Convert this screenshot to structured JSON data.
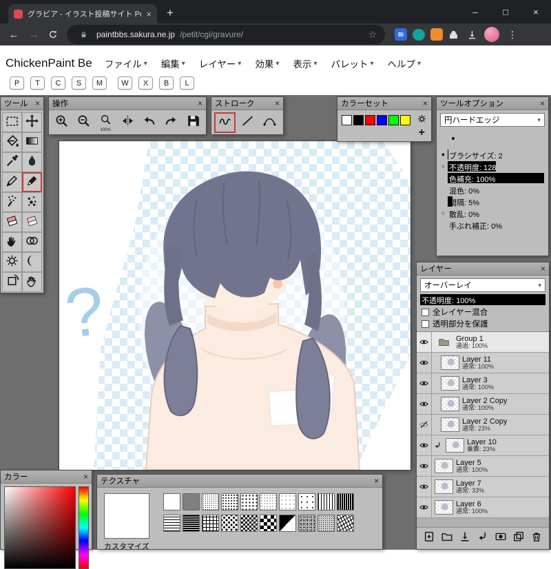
{
  "ui": {
    "close_glyph": "×",
    "caret": "▾"
  },
  "browser": {
    "tab": {
      "title": "グラビア - イラスト投稿サイト Petit N"
    },
    "new_tab_button": "+",
    "window_controls": {
      "minimize": "–",
      "maximize": "□",
      "close": "×"
    },
    "nav": {
      "back": "←",
      "forward": "→"
    },
    "omnibox": {
      "domain": "paintbbs.sakura.ne.jp",
      "path": "/petit/cgi/gravure/",
      "star": "☆"
    },
    "extensions": [
      {
        "label": "Bl",
        "color": "#2f6bdf",
        "shape": "square"
      },
      {
        "label": "",
        "color": "#17a398",
        "shape": "circle"
      },
      {
        "label": "",
        "color": "#ef8b2d",
        "shape": "square"
      }
    ],
    "menu_dots": "⋮"
  },
  "app": {
    "title": "ChickenPaint Be",
    "menus": [
      "ファイル",
      "編集",
      "レイヤー",
      "効果",
      "表示",
      "パレット",
      "ヘルプ"
    ],
    "shortcut_keys": [
      "P",
      "T",
      "C",
      "S",
      "M",
      "W",
      "X",
      "B",
      "L"
    ]
  },
  "palettes": {
    "tool": {
      "title": "ツール",
      "selected": "pen",
      "tools": [
        "rect-select",
        "move",
        "flood-fill",
        "gradient",
        "color-picker",
        "water",
        "pencil",
        "pen",
        "airbrush",
        "dots",
        "eraser",
        "soft-eraser",
        "smudge",
        "blend",
        "dodge",
        "burn",
        "rotate-canvas",
        "hand"
      ]
    },
    "misc": {
      "title": "操作",
      "actions": [
        {
          "id": "zoom-in"
        },
        {
          "id": "zoom-out"
        },
        {
          "id": "zoom-100",
          "label": "100%"
        },
        {
          "id": "flip-horizontal"
        },
        {
          "id": "undo"
        },
        {
          "id": "redo"
        },
        {
          "id": "save"
        }
      ]
    },
    "stroke": {
      "title": "ストローク",
      "selected": "freehand",
      "modes": [
        "freehand",
        "line",
        "bezier"
      ]
    },
    "swatches": {
      "title": "カラーセット",
      "plus": "+",
      "colors": [
        "#ffffff",
        "#000000",
        "#ff0000",
        "#0000ff",
        "#00ff00",
        "#ffff00"
      ]
    },
    "brush": {
      "title": "ツールオプション",
      "tip_name": "円ハードエッジ",
      "settings": [
        {
          "label": "ブラシサイズ: 2",
          "fill": 1,
          "circle": "filled"
        },
        {
          "label": "不透明度: 128",
          "fill": 50,
          "circle": "empty"
        },
        {
          "label": "色補充: 100%",
          "fill": 100,
          "circle": null
        },
        {
          "label": "混色: 0%",
          "fill": 0,
          "circle": null
        },
        {
          "label": "間隔: 5%",
          "fill": 5,
          "circle": null
        },
        {
          "label": "散乱: 0%",
          "fill": 0,
          "circle": "empty"
        },
        {
          "label": "手ぶれ補正: 0%",
          "fill": 0,
          "circle": null
        }
      ]
    },
    "layers": {
      "title": "レイヤー",
      "blend_mode": "オーバーレイ",
      "opacity_label": "不透明度: 100%",
      "opacity_fill": 100,
      "checkboxes": [
        "全レイヤー混合",
        "透明部分を保護"
      ],
      "items": [
        {
          "name": "Group 1",
          "mode": "通過: 100%",
          "visible": true,
          "type": "group",
          "selected": true
        },
        {
          "name": "Layer 11",
          "mode": "通常: 100%",
          "visible": true,
          "indent": 1
        },
        {
          "name": "Layer 3",
          "mode": "通常: 100%",
          "visible": true,
          "indent": 1
        },
        {
          "name": "Layer 2 Copy",
          "mode": "通常: 100%",
          "visible": true,
          "indent": 1
        },
        {
          "name": "Layer 2 Copy",
          "mode": "通常: 23%",
          "visible": false,
          "indent": 1
        },
        {
          "name": "Layer 10",
          "mode": "乗算: 23%",
          "visible": true,
          "clip": true
        },
        {
          "name": "Layer 5",
          "mode": "通常: 100%",
          "visible": true
        },
        {
          "name": "Layer 7",
          "mode": "通常: 33%",
          "visible": true
        },
        {
          "name": "Layer 6",
          "mode": "通常: 100%",
          "visible": true
        }
      ],
      "footer_actions": [
        "add-layer",
        "add-folder",
        "import",
        "clip",
        "mask",
        "duplicate",
        "delete"
      ]
    },
    "color": {
      "title": "カラー"
    },
    "texture": {
      "title": "テクスチャ",
      "customize_label": "カスタマイズ",
      "rows": [
        [
          "plain",
          "gray50",
          "dots-dense",
          "dots-med",
          "dots-mid",
          "dots-fine",
          "dots-sparse",
          "dots-xsparse",
          "vlines",
          "vlines-dense"
        ],
        [
          "hlines",
          "hlines-dense",
          "grid",
          "dots-offset",
          "checker-small",
          "checker-mid",
          "diag-half",
          "noise",
          "noise-fine",
          "scribble"
        ]
      ]
    }
  },
  "canvas": {
    "question_mark": "?"
  }
}
